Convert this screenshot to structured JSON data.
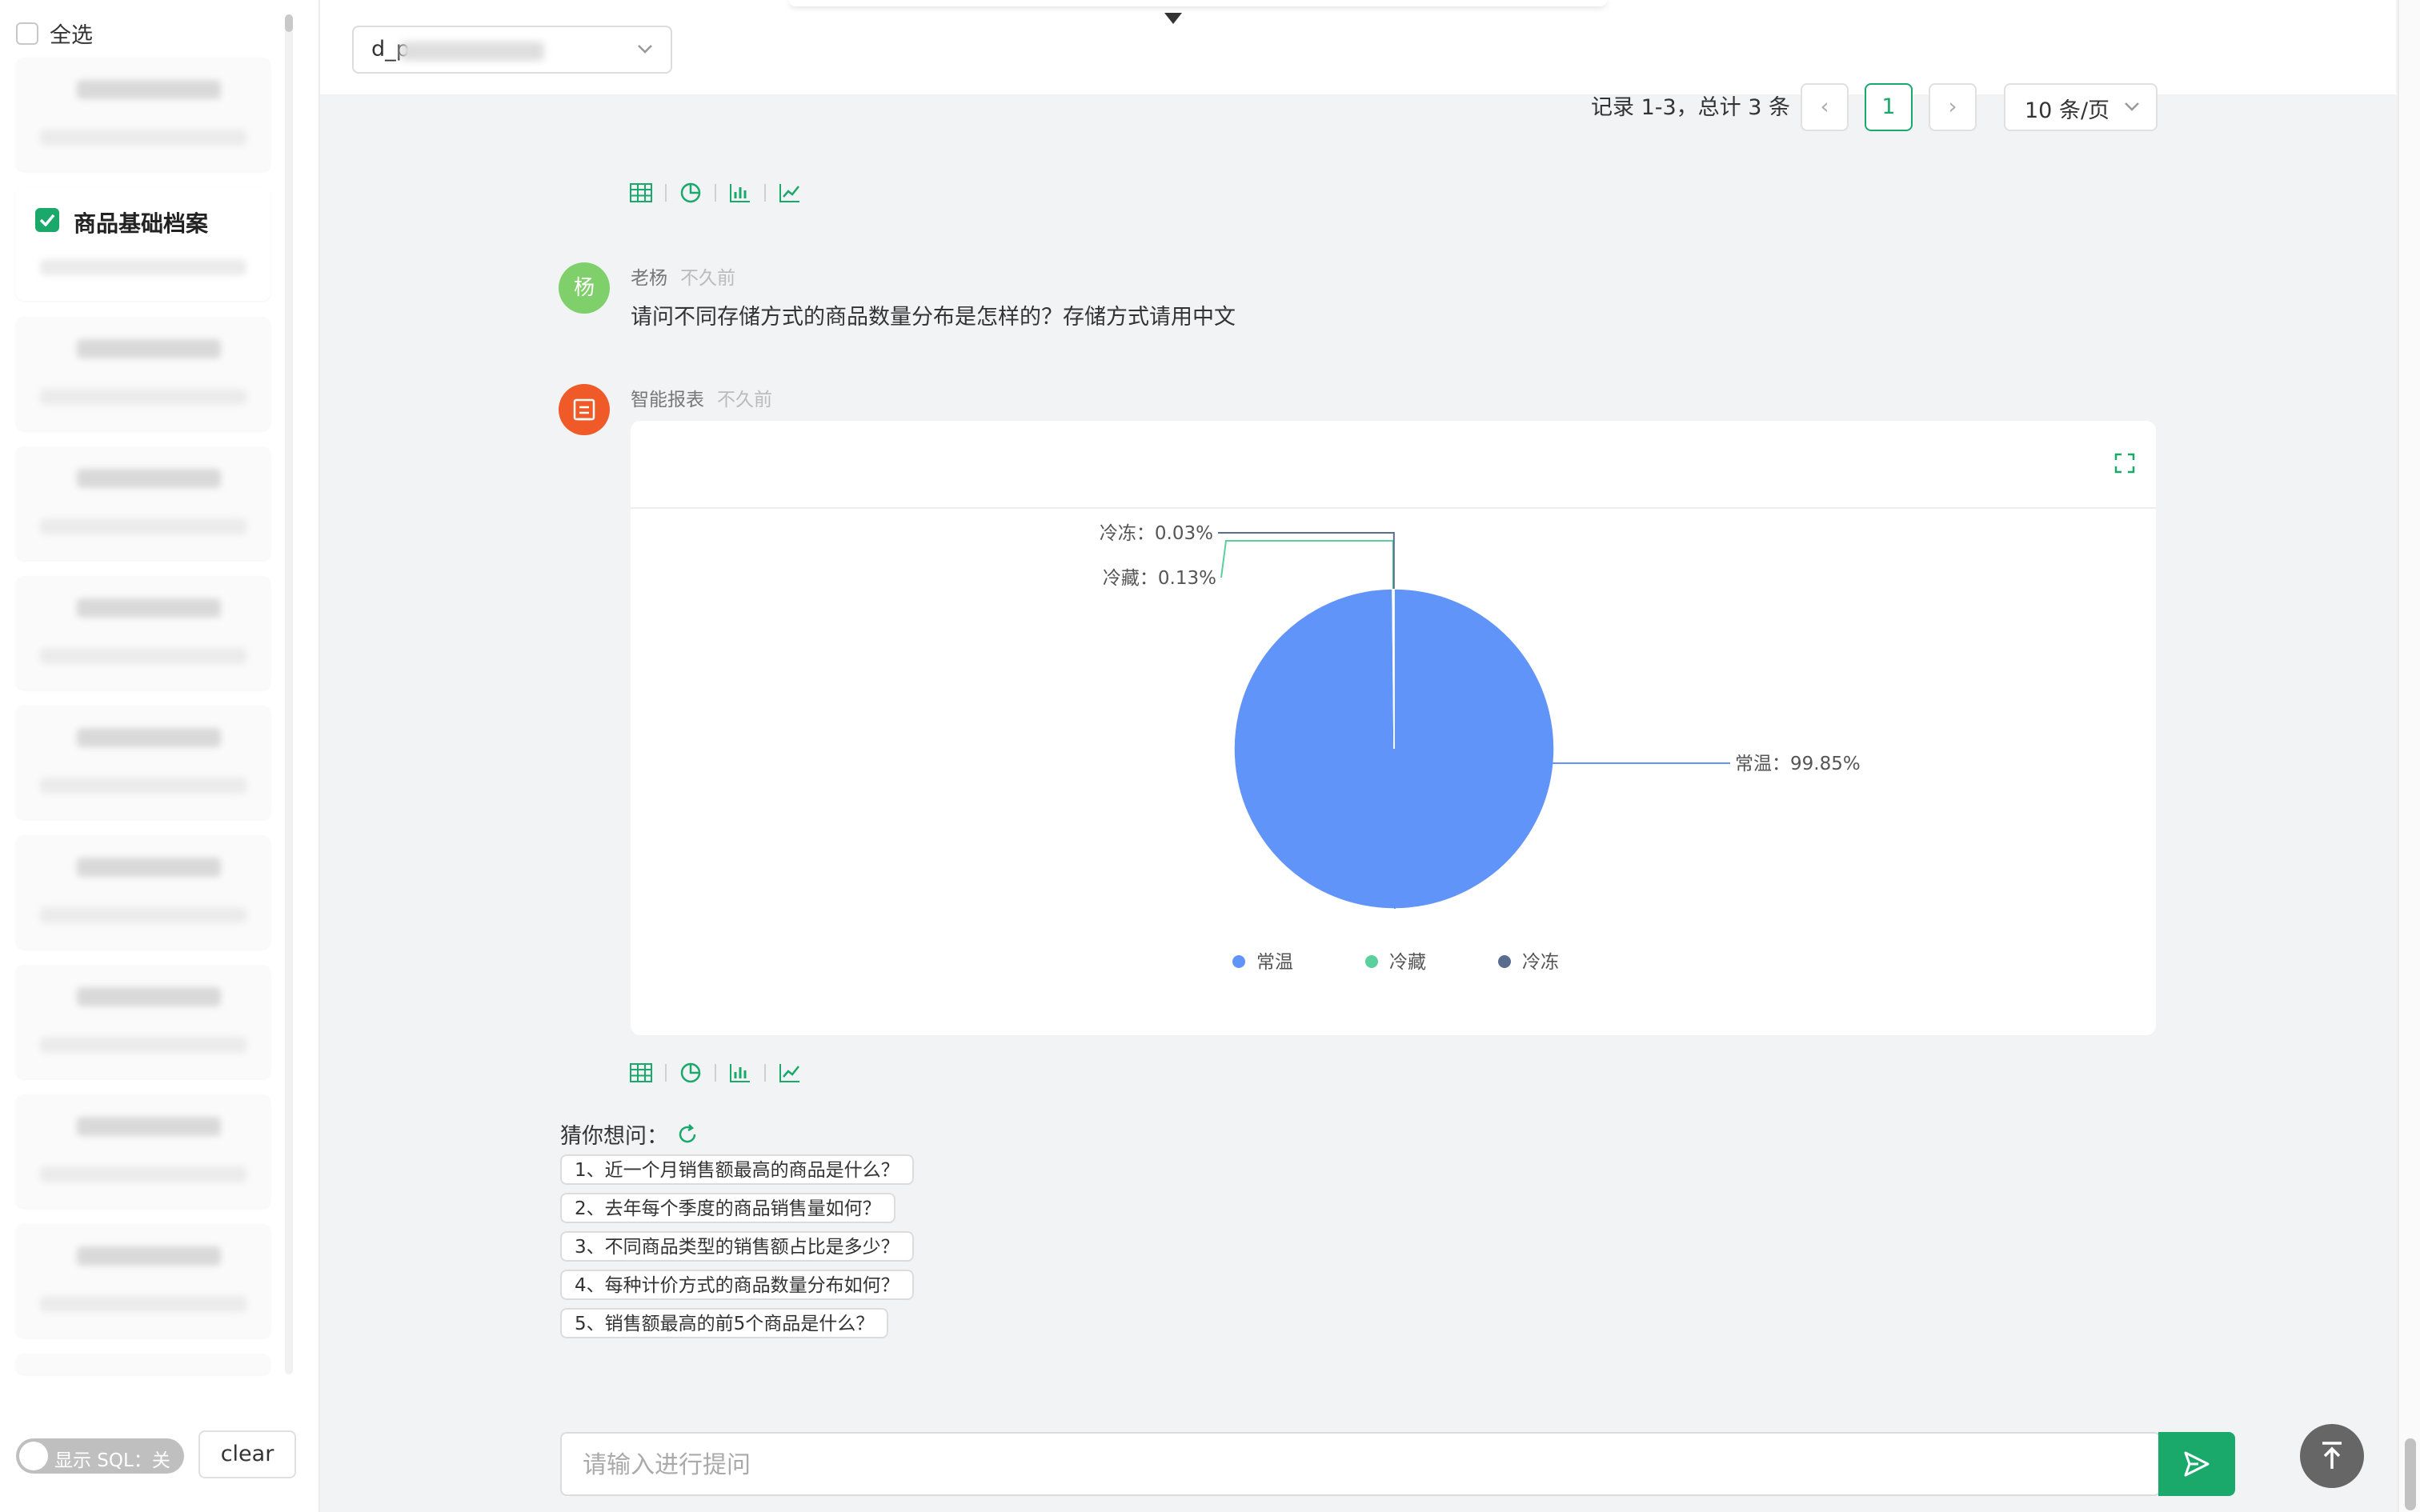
{
  "sidebar": {
    "select_all_label": "全选",
    "checked_table_name": "商品基础档案",
    "show_sql_label": "显示 SQL：关",
    "clear_label": "clear"
  },
  "header": {
    "database_select_value": "d_p"
  },
  "pagination": {
    "info": "记录 1-3，总计 3 条",
    "prev": "‹",
    "current_page": "1",
    "next": "›",
    "page_size": "10 条/页"
  },
  "messages": [
    {
      "avatar_text": "杨",
      "name": "老杨",
      "time": "不久前",
      "text": "请问不同存储方式的商品数量分布是怎样的？存储方式请用中文"
    },
    {
      "name": "智能报表",
      "time": "不久前"
    }
  ],
  "chart_data": {
    "type": "pie",
    "labels": [
      "常温",
      "冷藏",
      "冷冻"
    ],
    "values": [
      99.85,
      0.13,
      0.03
    ],
    "data_labels": [
      "常温：99.85%",
      "冷藏：0.13%",
      "冷冻：0.03%"
    ],
    "colors": [
      "#6194f8",
      "#5ccf9e",
      "#5a6d8f"
    ],
    "legend": [
      "常温",
      "冷藏",
      "冷冻"
    ],
    "legend_position": "bottom"
  },
  "suggestions": {
    "title": "猜你想问：",
    "items": [
      "1、近一个月销售额最高的商品是什么？",
      "2、去年每个季度的商品销售量如何？",
      "3、不同商品类型的销售额占比是多少？",
      "4、每种计价方式的商品数量分布如何？",
      "5、销售额最高的前5个商品是什么？"
    ]
  },
  "input": {
    "placeholder": "请输入进行提问"
  },
  "colors": {
    "accent": "#1aa86b",
    "user_avatar": "#7fcf6a",
    "bot_avatar": "#f05a28"
  }
}
